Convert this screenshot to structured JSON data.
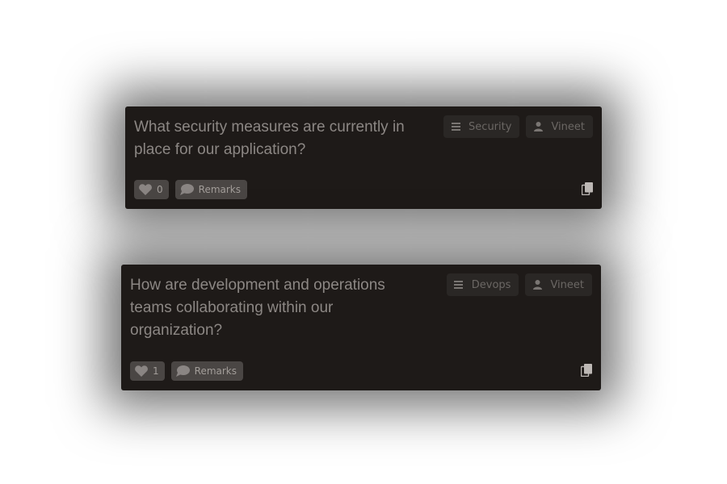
{
  "cards": [
    {
      "question": "What security measures are currently in place for our application?",
      "category": "Security",
      "author": "Vineet",
      "likes": "0",
      "remarks_label": "Remarks"
    },
    {
      "question": "How are development and operations teams collaborating within our organization?",
      "category": "Devops",
      "author": "Vineet",
      "likes": "1",
      "remarks_label": "Remarks"
    }
  ],
  "icons": {
    "category": "list-icon",
    "author": "user-icon",
    "like": "heart-icon",
    "remarks": "comment-icon",
    "copy": "copy-icon"
  },
  "colors": {
    "card_background": "#1e1a18",
    "question_text": "#8c8784",
    "tag_background": "#2a2725",
    "pill_background": "#4a4644"
  }
}
